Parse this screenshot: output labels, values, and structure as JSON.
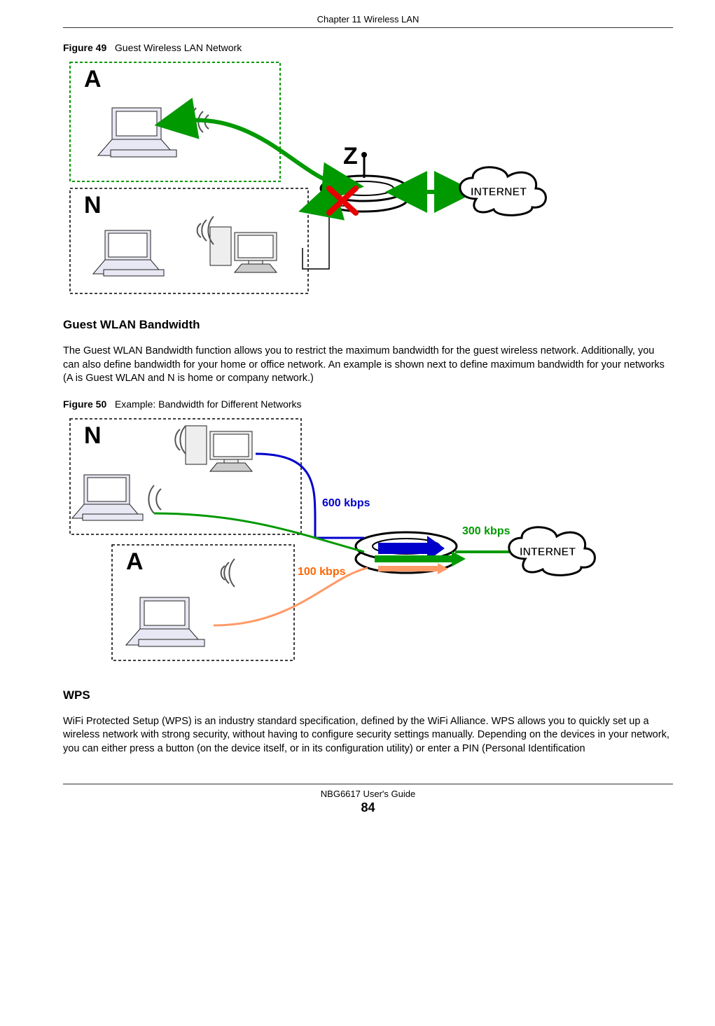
{
  "header": {
    "chapter": "Chapter 11 Wireless LAN"
  },
  "figure49": {
    "label": "Figure 49",
    "caption": "Guest Wireless LAN Network",
    "labels": {
      "A": "A",
      "N": "N",
      "Z": "Z",
      "internet": "INTERNET"
    }
  },
  "section1": {
    "title": "Guest WLAN Bandwidth",
    "paragraph": "The Guest WLAN Bandwidth function allows you to restrict the maximum bandwidth for the guest wireless network. Additionally, you can also define bandwidth for your home or office network. An example is shown next to define maximum bandwidth for your networks (A is Guest WLAN and N is home or company network.)"
  },
  "figure50": {
    "label": "Figure 50",
    "caption": "Example: Bandwidth for Different Networks",
    "labels": {
      "N": "N",
      "A": "A",
      "bw600": "600 kbps",
      "bw300": "300 kbps",
      "bw100": "100 kbps",
      "internet": "INTERNET"
    }
  },
  "section2": {
    "title": "WPS",
    "paragraph": "WiFi Protected Setup (WPS) is an industry standard specification, defined by the WiFi Alliance. WPS allows you to quickly set up a wireless network with strong security, without having to configure security settings manually. Depending on the devices in your network, you can either press a button (on the device itself, or in its configuration utility) or enter a PIN (Personal Identification"
  },
  "footer": {
    "guide": "NBG6617 User's Guide",
    "page": "84"
  }
}
